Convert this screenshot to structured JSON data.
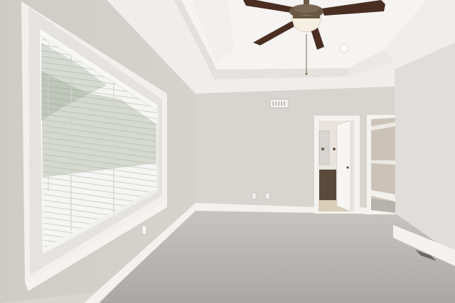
{
  "scene": {
    "kind": "empty-room-photo",
    "palette": {
      "wall_left": "#d3d0cb",
      "wall_back": "#d8d5d0",
      "wall_right": "#e0dedb",
      "ceiling": "#f0efed",
      "ceiling_tray": "#e7e5e2",
      "carpet": "#b9b7b4",
      "trim": "#f3f2ef",
      "window_light": "#f4f4f2",
      "fan_blade": "#4a2e22",
      "fan_bronze": "#6b5846",
      "closet_wall": "#cbc3b8",
      "vanity": "#5a4a3c"
    },
    "elements": [
      "ceiling-fan",
      "tray-ceiling",
      "window-with-blinds",
      "hvac-vent",
      "bathroom-doorway",
      "closet-doorway",
      "baseboards",
      "carpet-floor",
      "wall-outlets"
    ]
  }
}
